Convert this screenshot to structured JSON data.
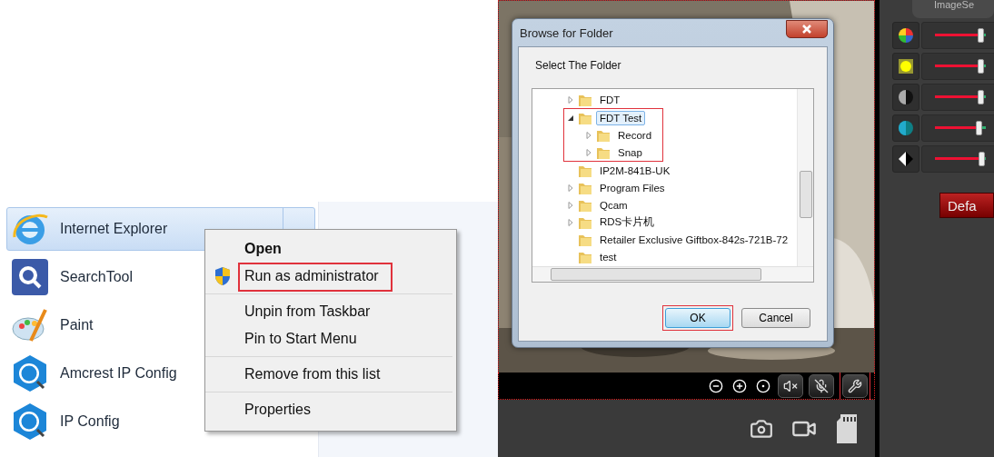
{
  "start_menu": {
    "items": [
      {
        "label": "Internet Explorer",
        "kind": "browser",
        "selected": true
      },
      {
        "label": "SearchTool",
        "kind": "search",
        "selected": false
      },
      {
        "label": "Paint",
        "kind": "paint",
        "selected": false
      },
      {
        "label": "Amcrest IP Config",
        "kind": "ip",
        "selected": false
      },
      {
        "label": "IP Config",
        "kind": "ip",
        "selected": false
      }
    ]
  },
  "context_menu": {
    "groups": [
      [
        {
          "label": "Open",
          "bold": true,
          "elevated": false,
          "annotated": false
        },
        {
          "label": "Run as administrator",
          "bold": false,
          "elevated": true,
          "annotated": true
        }
      ],
      [
        {
          "label": "Unpin from Taskbar",
          "bold": false,
          "elevated": false,
          "annotated": false
        },
        {
          "label": "Pin to Start Menu",
          "bold": false,
          "elevated": false,
          "annotated": false
        }
      ],
      [
        {
          "label": "Remove from this list",
          "bold": false,
          "elevated": false,
          "annotated": false
        }
      ],
      [
        {
          "label": "Properties",
          "bold": false,
          "elevated": false,
          "annotated": false
        }
      ]
    ]
  },
  "dialog": {
    "title": "Browse for Folder",
    "prompt": "Select The Folder",
    "tree": [
      {
        "label": "FDT",
        "expandable": true,
        "expanded": false,
        "selected": false,
        "annotated": false
      },
      {
        "label": "FDT Test",
        "expandable": true,
        "expanded": true,
        "selected": true,
        "annotated": true,
        "children": [
          {
            "label": "Record",
            "expandable": true,
            "expanded": false,
            "selected": false,
            "annotated": false
          },
          {
            "label": "Snap",
            "expandable": true,
            "expanded": false,
            "selected": false,
            "annotated": false
          }
        ]
      },
      {
        "label": "IP2M-841B-UK",
        "expandable": false,
        "selected": false,
        "annotated": false
      },
      {
        "label": "Program Files",
        "expandable": true,
        "expanded": false,
        "selected": false,
        "annotated": false
      },
      {
        "label": "Qcam",
        "expandable": true,
        "expanded": false,
        "selected": false,
        "annotated": false
      },
      {
        "label": "RDS卡片机",
        "expandable": true,
        "expanded": false,
        "selected": false,
        "annotated": false
      },
      {
        "label": "Retailer Exclusive Giftbox-842s-721B-72",
        "expandable": false,
        "selected": false,
        "annotated": false
      },
      {
        "label": "test",
        "expandable": false,
        "selected": false,
        "annotated": false
      }
    ],
    "buttons": [
      {
        "label": "OK",
        "default": true,
        "annotated": true
      },
      {
        "label": "Cancel",
        "default": false,
        "annotated": false
      }
    ]
  },
  "player": {
    "controls": [
      {
        "kind": "zoom-out",
        "annotated": false
      },
      {
        "kind": "zoom-in",
        "annotated": false
      },
      {
        "kind": "dot",
        "annotated": false
      },
      {
        "kind": "mute",
        "annotated": false
      },
      {
        "kind": "mic-off",
        "annotated": false
      },
      {
        "kind": "tools",
        "annotated": true
      }
    ],
    "actions": [
      {
        "kind": "camera"
      },
      {
        "kind": "video"
      },
      {
        "kind": "sd"
      }
    ]
  },
  "image_panel": {
    "tab": "ImageSe",
    "sliders": [
      {
        "kind": "color",
        "level": 0.96
      },
      {
        "kind": "brightness",
        "level": 0.96
      },
      {
        "kind": "contrast",
        "level": 0.96
      },
      {
        "kind": "saturation",
        "level": 0.9
      },
      {
        "kind": "sharpness",
        "level": 0.98
      }
    ],
    "default_button": "Defa"
  }
}
